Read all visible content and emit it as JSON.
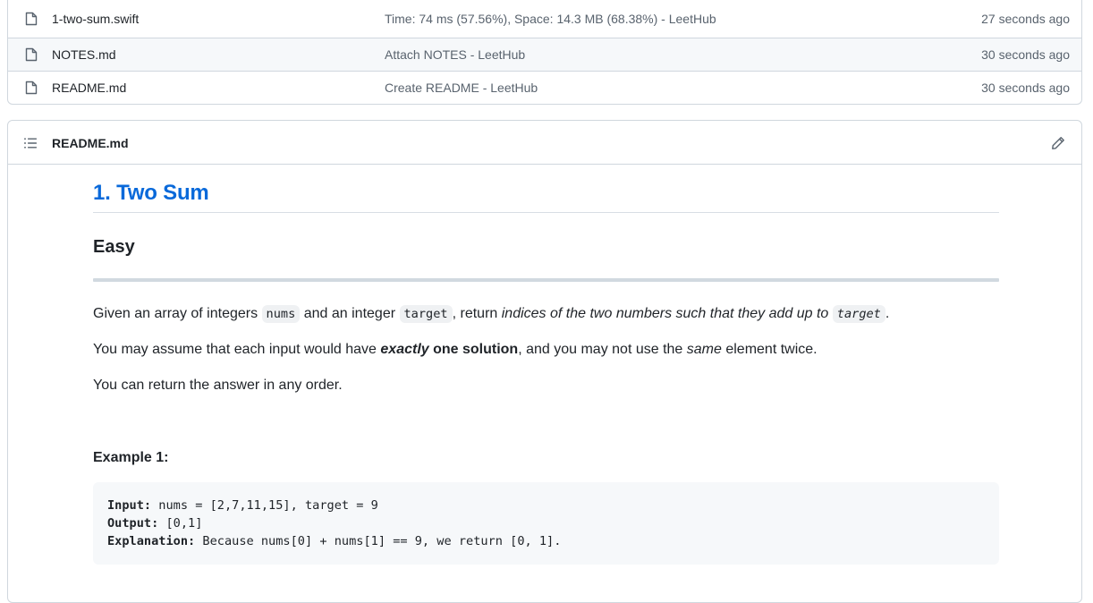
{
  "files": [
    {
      "name": "1-two-sum.swift",
      "message": "Time: 74 ms (57.56%), Space: 14.3 MB (68.38%) - LeetHub",
      "age": "27 seconds ago"
    },
    {
      "name": "NOTES.md",
      "message": "Attach NOTES - LeetHub",
      "age": "30 seconds ago"
    },
    {
      "name": "README.md",
      "message": "Create README - LeetHub",
      "age": "30 seconds ago"
    }
  ],
  "readme": {
    "title": "README.md",
    "h1": "1. Two Sum",
    "difficulty": "Easy",
    "p1": {
      "t1": "Given an array of integers ",
      "c1": "nums",
      "t2": " and an integer ",
      "c2": "target",
      "t3": ", return ",
      "em": "indices of the two numbers such that they add up to",
      "t4": " ",
      "c3": "target",
      "t5": "."
    },
    "p2": {
      "t1": "You may assume that each input would have ",
      "em_strong": "exactly",
      "strong": " one solution",
      "t2": ", and you may not use the ",
      "em": "same",
      "t3": " element twice."
    },
    "p3": "You can return the answer in any order.",
    "example_title": "Example 1:",
    "example": {
      "input_label": "Input:",
      "input_value": " nums = [2,7,11,15], target = 9",
      "output_label": "Output:",
      "output_value": " [0,1]",
      "explanation_label": "Explanation:",
      "explanation_value": " Because nums[0] + nums[1] == 9, we return [0, 1]."
    }
  },
  "icons": {
    "file": "file-icon",
    "toc": "list-unordered-icon",
    "edit": "pencil-icon"
  },
  "colors": {
    "link": "#0969da",
    "muted": "#59636e",
    "border": "#d0d7de"
  }
}
